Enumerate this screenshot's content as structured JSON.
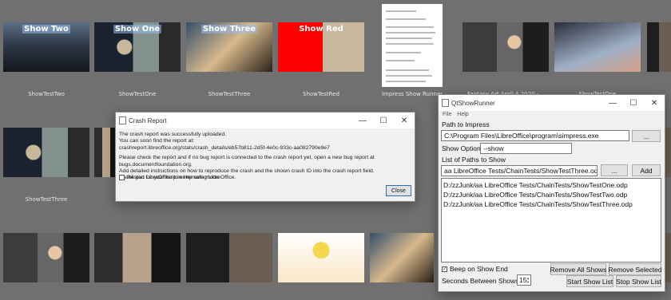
{
  "thumbnails": [
    {
      "banner": "Show Two",
      "caption": "ShowTestTwo"
    },
    {
      "banner": "Show One",
      "caption": "ShowTestOne"
    },
    {
      "banner": "Show Three",
      "caption": "ShowTestThree"
    },
    {
      "banner": "Show Red",
      "caption": "ShowTestRed"
    },
    {
      "caption": "Impress Show Runner"
    },
    {
      "caption": "Fantasy Art April 4 2020 -..."
    },
    {
      "caption": "ShowTestOne"
    },
    {
      "caption": "ShowTestThree"
    }
  ],
  "crash_report": {
    "title": "Crash Report",
    "line1": "The crash report was successfully uploaded.",
    "line2": "You can soon find the report at:",
    "line3": "crashreport.libreoffice.org/stats/crash_details/eb57b811-2d5f-4e0c-933c-aa082790e9e7",
    "line4": "Please check the report and if no bug report is connected to the crash report yet, open a new bug report at bugs.documentfoundation.org.",
    "line5": "Add detailed instructions on how to reproduce the crash and the shown crash ID into the crash report field.",
    "line6": "Thank you for your help in improving LibreOffice.",
    "safe_mode_label": "Restart LibreOffice to enter safe mode",
    "close_label": "Close"
  },
  "qtshowrunner": {
    "title": "QtShowRunner",
    "menu": [
      "File",
      "Help"
    ],
    "path_label": "Path to Impress",
    "path_value": "C:\\Program Files\\LibreOffice\\program\\simpress.exe",
    "browse_label": "...",
    "show_option_label": "Show Option",
    "show_option_value": "--show",
    "paths_label": "List of Paths to Show",
    "new_path_value": "aa LibreOffice Tests/ChainTests/ShowTestThree.odp",
    "browse2_label": "...",
    "add_label": "Add",
    "paths": [
      "D:/zzJunk/aa LibreOffice Tests/ChainTests/ShowTestOne.odp",
      "D:/zzJunk/aa LibreOffice Tests/ChainTests/ShowTestTwo.odp",
      "D:/zzJunk/aa LibreOffice Tests/ChainTests/ShowTestThree.odp"
    ],
    "beep_label": "Beep on Show End",
    "beep_checked": true,
    "remove_all_label": "Remove All Shows",
    "remove_selected_label": "Remove Selected",
    "seconds_label": "Seconds Between Shows",
    "seconds_value": "15",
    "start_label": "Start Show List",
    "stop_label": "Stop Show List"
  },
  "colors": {
    "desktop": "#707070",
    "red_slide": "#ff0000",
    "accent": "#3a6ea8"
  }
}
